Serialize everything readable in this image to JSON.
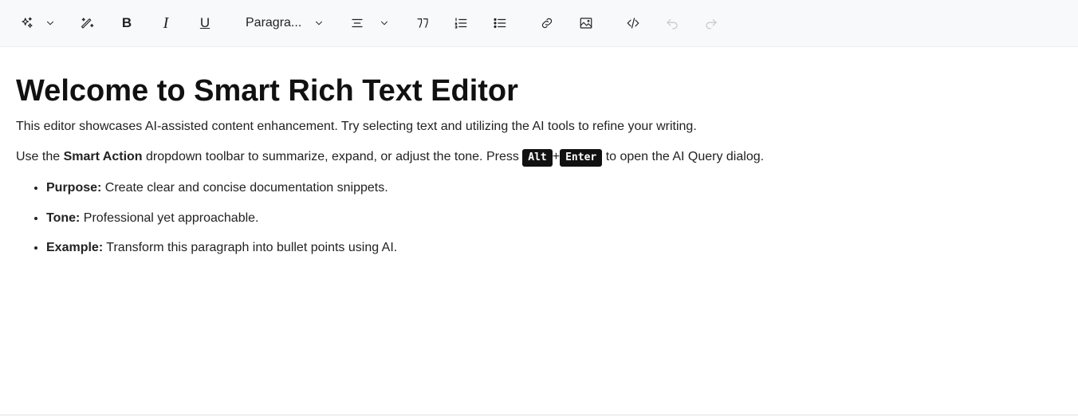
{
  "toolbar": {
    "bold": "B",
    "italic": "I",
    "underline": "U",
    "format_select": "Paragra...",
    "icons": [
      "sparkles-icon",
      "chevron-down-icon",
      "magic-wand-icon",
      "bold-icon",
      "italic-icon",
      "underline-icon",
      "chevron-down-icon",
      "align-icon",
      "chevron-down-icon",
      "blockquote-icon",
      "ordered-list-icon",
      "unordered-list-icon",
      "link-icon",
      "image-icon",
      "code-icon",
      "undo-icon",
      "redo-icon"
    ]
  },
  "content": {
    "title": "Welcome to Smart Rich Text Editor",
    "para1": "This editor showcases AI-assisted content enhancement. Try selecting text and utilizing the AI tools to refine your writing.",
    "para2": {
      "pre": "Use the ",
      "bold": "Smart Action",
      "mid": " dropdown toolbar to summarize, expand, or adjust the tone. Press ",
      "key1": "Alt",
      "plus": "+",
      "key2": "Enter",
      "post": " to open the AI Query dialog."
    },
    "list": [
      {
        "label": "Purpose:",
        "text": " Create clear and concise documentation snippets."
      },
      {
        "label": "Tone:",
        "text": " Professional yet approachable."
      },
      {
        "label": "Example:",
        "text": " Transform this paragraph into bullet points using AI."
      }
    ]
  }
}
